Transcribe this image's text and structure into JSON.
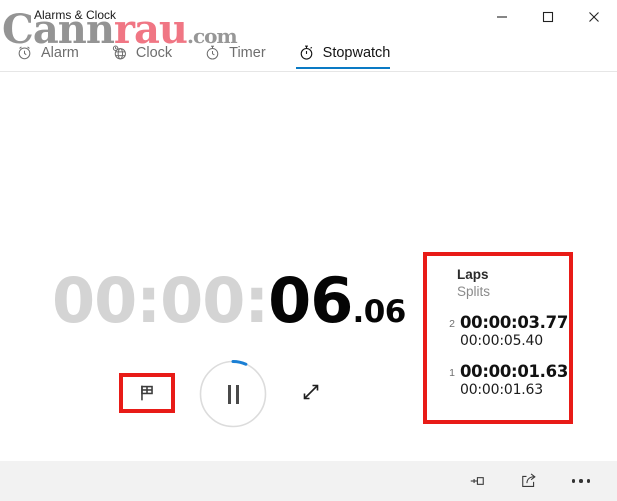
{
  "window": {
    "title": "Alarms & Clock",
    "controls": [
      {
        "name": "minimize",
        "label": "—"
      },
      {
        "name": "maximize",
        "label": "☐"
      },
      {
        "name": "close",
        "label": "✕"
      }
    ]
  },
  "watermark": {
    "part1": "Cann",
    "part2": "rau",
    "part3": ".com",
    "color_gray": "#8c8c8c",
    "color_red": "#ef6b7a"
  },
  "tabs": [
    {
      "label": "Alarm",
      "icon": "alarm-clock-icon",
      "active": false
    },
    {
      "label": "Clock",
      "icon": "globe-clock-icon",
      "active": false
    },
    {
      "label": "Timer",
      "icon": "timer-icon",
      "active": false
    },
    {
      "label": "Stopwatch",
      "icon": "stopwatch-icon",
      "active": true
    }
  ],
  "stopwatch": {
    "time_dim": "00:00:",
    "time_main": "06",
    "time_fraction": ".06",
    "progress_percent": 6,
    "accent_color": "#0a7ac4",
    "highlight_color": "#e81b17",
    "buttons": {
      "lap": "lap-flag-icon",
      "playpause": "pause-icon",
      "expand": "expand-icon"
    }
  },
  "laps": {
    "header_laps": "Laps",
    "header_splits": "Splits",
    "rows": [
      {
        "number": "2",
        "lap": "00:00:03.77",
        "split": "00:00:05.40"
      },
      {
        "number": "1",
        "lap": "00:00:01.63",
        "split": "00:00:01.63"
      }
    ]
  },
  "bottom_bar": {
    "buttons": [
      {
        "name": "pin-icon",
        "label": "Pin"
      },
      {
        "name": "share-icon",
        "label": "Share"
      },
      {
        "name": "more-icon",
        "label": "See more"
      }
    ]
  }
}
